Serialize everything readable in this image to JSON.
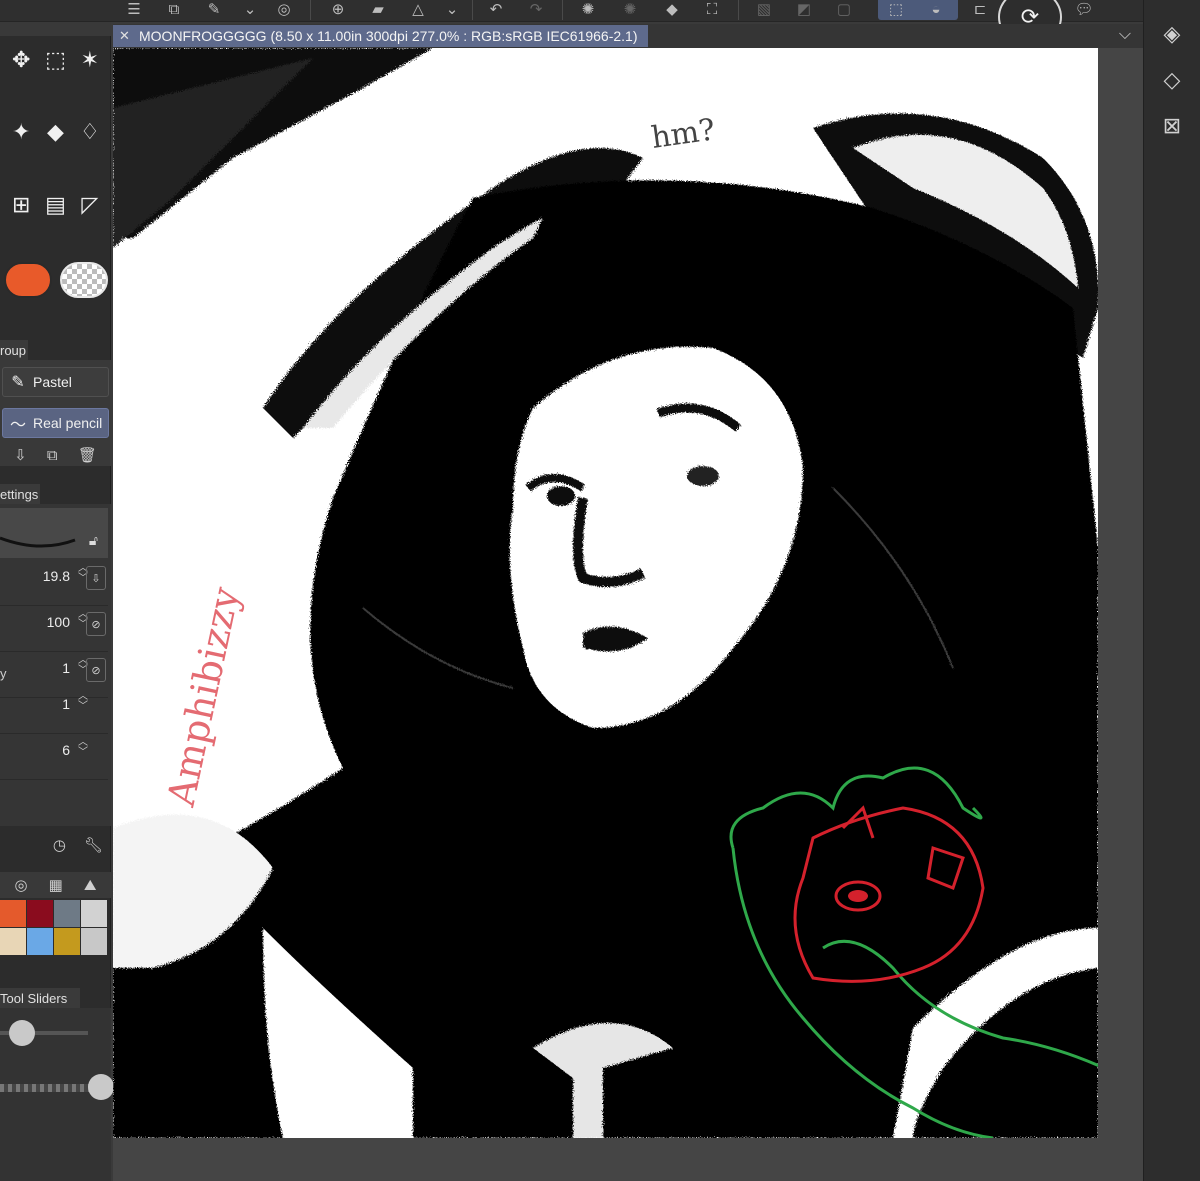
{
  "document": {
    "tab_title": "MOONFROGGGGG (8.50 x 11.00in 300dpi 277.0% : RGB:sRGB IEC61966-2.1)",
    "close_glyph": "✕",
    "chevron_glyph": "⌵"
  },
  "toolbar": {
    "icons": [
      "menu-icon",
      "new-file-icon",
      "open-file-icon",
      "chevron-down-icon",
      "save-icon",
      "fill-icon",
      "clear-icon",
      "undo-icon",
      "redo-icon",
      "loading-icon",
      "fill-bucket-icon",
      "transform-icon",
      "select-all-icon",
      "deselect-icon",
      "crop-icon",
      "selection-active-icon",
      "flip-icon",
      "sync-icon",
      "chat-icon"
    ]
  },
  "tools": {
    "rows": [
      [
        "move-icon",
        "rectangle-select-icon",
        "auto-select-icon"
      ],
      [
        "sparkle-icon",
        "eraser-icon",
        "blend-icon"
      ],
      [
        "fill-icon",
        "gradient-icon",
        "ruler-icon"
      ]
    ]
  },
  "colors": {
    "main": "#e85a2a",
    "palette": [
      "#e45a2c",
      "#8a0c1e",
      "#6e7a86",
      "#d2d2d2",
      "#e8d6b6",
      "#6aa8e6",
      "#c49a1e",
      "#c8c8c8"
    ]
  },
  "brushes": {
    "group_label": "roup",
    "items": [
      {
        "label": "Pastel",
        "icon": "pencil-icon",
        "selected": false
      },
      {
        "label": "Real pencil",
        "icon": "pencil-stroke-icon",
        "selected": true
      }
    ]
  },
  "tool_settings": {
    "tab_label": "ettings",
    "params": [
      {
        "label": "",
        "value": "19.8"
      },
      {
        "label": "",
        "value": "100"
      },
      {
        "label": "y",
        "value": "1"
      },
      {
        "label": "",
        "value": "1"
      },
      {
        "label": "",
        "value": "6"
      }
    ]
  },
  "sliders": {
    "label": "Tool Sliders",
    "size_level": 0.25,
    "opacity_level": 1.0
  },
  "canvas": {
    "annotations": {
      "question": "hm?",
      "signature": "Amphibizzy"
    }
  },
  "right_panel": {
    "icons": [
      "layers-icon",
      "layer-properties-icon",
      "close-panel-icon"
    ]
  }
}
